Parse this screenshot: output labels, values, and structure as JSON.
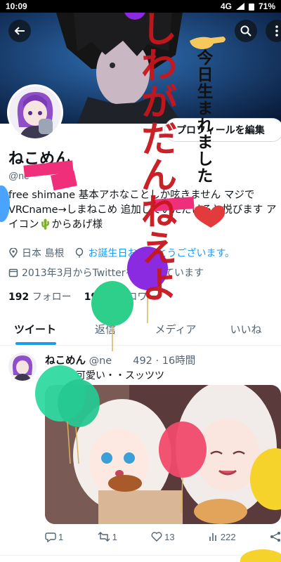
{
  "status_bar": {
    "time": "10:09",
    "network": "4G",
    "battery": "71%"
  },
  "profile": {
    "edit_button": "プロフィールを編集",
    "name": "ねこめん",
    "handle_visible": "@ne",
    "handle_suffix": "492",
    "bio": "free shimane 基本アホなことしか呟きません マジで VRCname→しまねこめ 追加していただけると悦びます アイコン🌵からあげ様",
    "location": "日本 島根",
    "birthday_text": "お誕生日おめでとうございます。",
    "joined": "2013年3月からTwitterを利用しています",
    "following_count": "192",
    "following_label": "フォロー",
    "followers_count": "191",
    "followers_label": "フォロワー"
  },
  "tabs": [
    {
      "label": "ツイート",
      "active": true
    },
    {
      "label": "返信",
      "active": false
    },
    {
      "label": "メディア",
      "active": false
    },
    {
      "label": "いいね",
      "active": false
    }
  ],
  "tweet": {
    "author": "ねこめん",
    "handle": "@ne",
    "handle_suffix": "492",
    "time": "16時間",
    "text": "可愛い・・スッツツ",
    "counts": {
      "reply": "1",
      "retweet": "1",
      "like": "13",
      "views": "222"
    }
  },
  "overlay": {
    "vertical_text": "今日生まれました",
    "red_text": "しわがだんね",
    "red_text_lower": "えよ"
  },
  "colors": {
    "accent": "#1d9bf0",
    "text": "#0f1419",
    "secondary": "#536471",
    "overlay_red": "#c8161d"
  }
}
